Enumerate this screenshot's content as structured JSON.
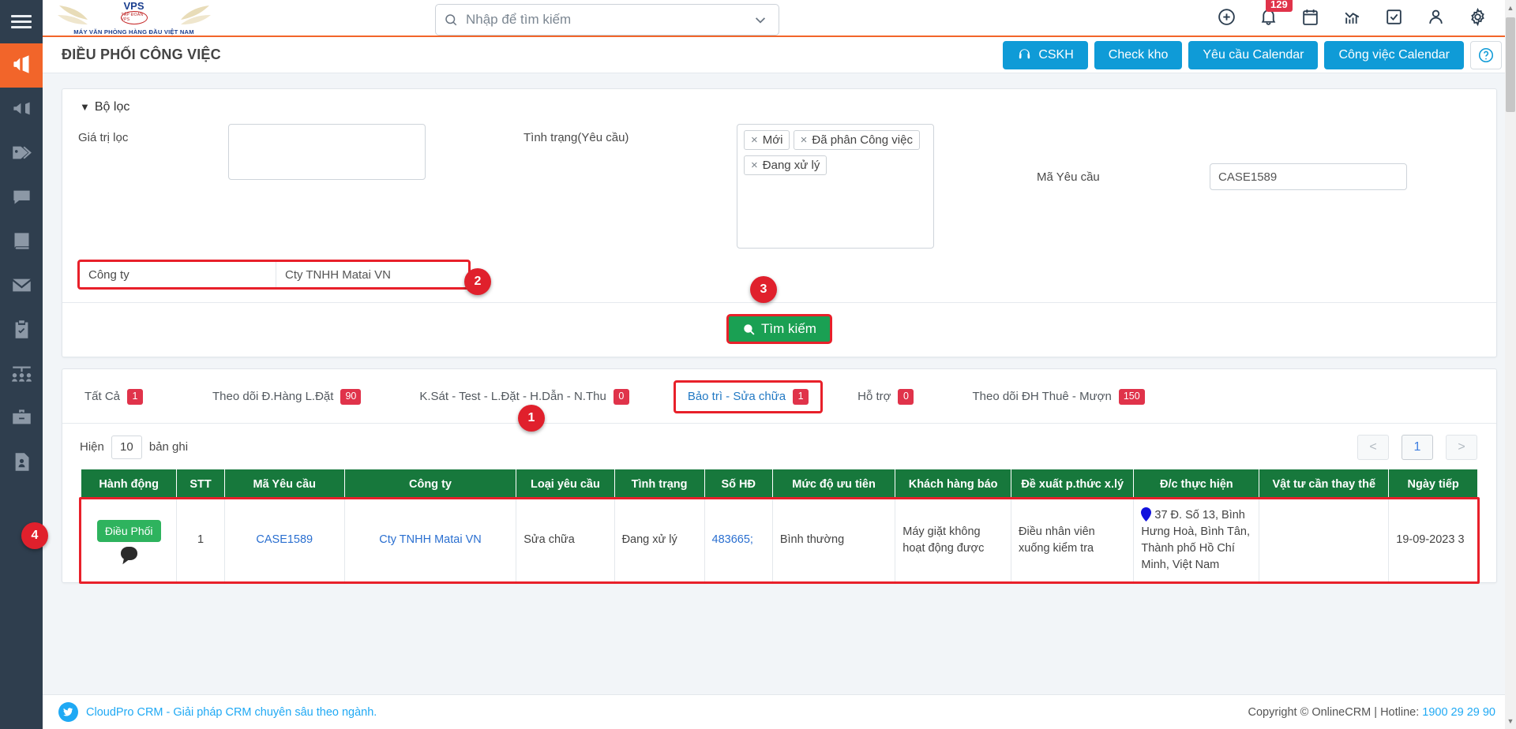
{
  "sidebar": {
    "menu_icon": "hamburger-menu-icon",
    "items": [
      {
        "icon": "megaphone-icon",
        "active": true
      },
      {
        "icon": "announcement-icon",
        "active": false
      },
      {
        "icon": "tags-icon",
        "active": false
      },
      {
        "icon": "chat-bubble-icon",
        "active": false
      },
      {
        "icon": "book-icon",
        "active": false
      },
      {
        "icon": "envelope-icon",
        "active": false
      },
      {
        "icon": "clipboard-check-icon",
        "active": false
      },
      {
        "icon": "users-group-icon",
        "active": false
      },
      {
        "icon": "briefcase-icon",
        "active": false
      },
      {
        "icon": "contact-card-icon",
        "active": false
      }
    ]
  },
  "brand": {
    "badge_name": "VPS",
    "badge_sub": "TẬP ĐOÀN VPS",
    "tagline": "MÁY VĂN PHÒNG HÀNG ĐẦU VIỆT NAM"
  },
  "search": {
    "placeholder": "Nhập để tìm kiếm",
    "value": "",
    "icon": "search-icon",
    "dropdown_icon": "chevron-down-icon"
  },
  "topbar_icons": [
    {
      "name": "plus-circle-icon",
      "badge": ""
    },
    {
      "name": "bell-icon",
      "badge": "129"
    },
    {
      "name": "calendar-icon",
      "badge": ""
    },
    {
      "name": "chart-icon",
      "badge": ""
    },
    {
      "name": "checkbox-icon",
      "badge": ""
    },
    {
      "name": "user-icon",
      "badge": ""
    },
    {
      "name": "gear-icon",
      "badge": ""
    }
  ],
  "page": {
    "title": "ĐIỀU PHỐI CÔNG VIỆC"
  },
  "header_buttons": [
    {
      "label": "CSKH",
      "icon": "headset-icon"
    },
    {
      "label": "Check kho",
      "icon": ""
    },
    {
      "label": "Yêu cầu Calendar",
      "icon": ""
    },
    {
      "label": "Công việc Calendar",
      "icon": ""
    }
  ],
  "help_button": {
    "icon": "question-circle-icon"
  },
  "filter": {
    "title": "Bộ lọc",
    "caret": "▼",
    "gia_tri_loc_label": "Giá trị lọc",
    "gia_tri_loc_value": "",
    "tinh_trang_label": "Tình trạng(Yêu cầu)",
    "tinh_trang_tags": [
      "Mới",
      "Đã phân Công việc",
      "Đang xử lý"
    ],
    "tag_remove_icon": "×",
    "ma_yeu_cau_label": "Mã Yêu cầu",
    "ma_yeu_cau_value": "CASE1589",
    "cong_ty_label": "Công ty",
    "cong_ty_value": "Cty TNHH Matai VN",
    "search_button_label": "Tìm kiếm",
    "search_button_icon": "search-icon"
  },
  "tabs": [
    {
      "label": "Tất Cả",
      "count": "1",
      "active": false
    },
    {
      "label": "Theo dõi Đ.Hàng L.Đặt",
      "count": "90",
      "active": false
    },
    {
      "label": "K.Sát - Test - L.Đặt - H.Dẫn - N.Thu",
      "count": "0",
      "active": false
    },
    {
      "label": "Bảo trì - Sửa chữa",
      "count": "1",
      "active": true
    },
    {
      "label": "Hỗ trợ",
      "count": "0",
      "active": false
    },
    {
      "label": "Theo dõi ĐH Thuê - Mượn",
      "count": "150",
      "active": false
    }
  ],
  "toolbar": {
    "show_prefix": "Hiện",
    "page_size": "10",
    "show_suffix": "bản ghi",
    "prev_label": "<",
    "current_page": "1",
    "next_label": ">"
  },
  "table": {
    "columns": [
      "Hành động",
      "STT",
      "Mã Yêu cầu",
      "Công ty",
      "Loại yêu cầu",
      "Tình trạng",
      "Số HĐ",
      "Mức độ ưu tiên",
      "Khách hàng báo",
      "Đề xuất p.thức x.lý",
      "Đ/c thực hiện",
      "Vật tư cần thay thế",
      "Ngày tiếp"
    ],
    "rows": [
      {
        "action_label": "Điều Phối",
        "action_icon": "comment-bubble-icon",
        "stt": "1",
        "ma_yeu_cau": "CASE1589",
        "cong_ty": "Cty TNHH Matai VN",
        "loai_yeu_cau": "Sửa chữa",
        "tinh_trang": "Đang xử lý",
        "so_hd": "483665;",
        "muc_do_uu_tien": "Bình thường",
        "khach_hang_bao": "Máy giặt không hoạt động được",
        "de_xuat": "Điều nhân viên xuống kiểm tra",
        "dia_chi_icon": "map-pin-icon",
        "dia_chi": "37 Đ. Số 13, Bình Hưng Hoà, Bình Tân, Thành phố Hồ Chí Minh, Việt Nam",
        "vat_tu": "",
        "ngay_tiep": "19-09-2023 3"
      }
    ]
  },
  "markers": [
    {
      "label": "1"
    },
    {
      "label": "2"
    },
    {
      "label": "3"
    },
    {
      "label": "4"
    }
  ],
  "footer": {
    "brand_icon": "bird-icon",
    "left_text": "CloudPro CRM - Giải pháp CRM chuyên sâu theo ngành.",
    "copyright": "Copyright © OnlineCRM | Hotline: ",
    "hotline": "1900 29 29 90"
  },
  "colors": {
    "accent_orange": "#f2652a",
    "brand_blue": "#0f9bd7",
    "table_header_green": "#17783c",
    "marker_red": "#e0202c",
    "link_blue": "#2a6fd0",
    "success_green": "#1aa053",
    "sidebar_dark": "#2f3e4e"
  }
}
